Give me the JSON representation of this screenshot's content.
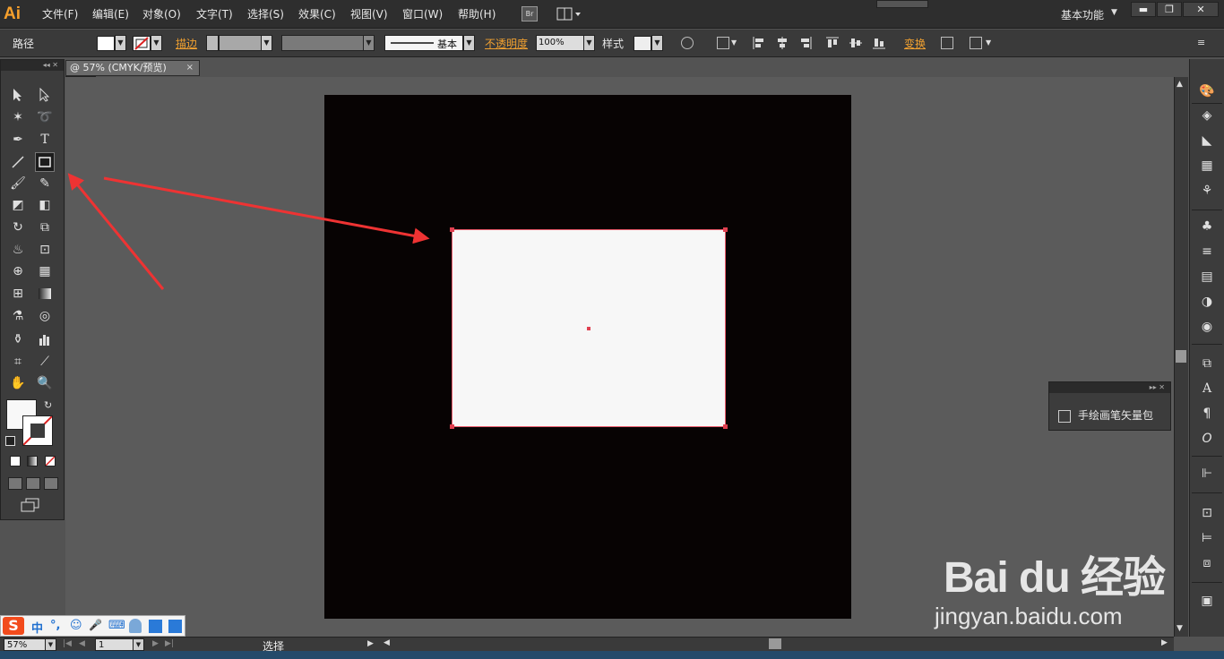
{
  "app": {
    "logo": "Ai"
  },
  "menu": {
    "items": [
      "文件(F)",
      "编辑(E)",
      "对象(O)",
      "文字(T)",
      "选择(S)",
      "效果(C)",
      "视图(V)",
      "窗口(W)",
      "帮助(H)"
    ],
    "bridge_label": "Br",
    "workspace": "基本功能"
  },
  "control_bar": {
    "object_type": "路径",
    "stroke_label": "描边",
    "stroke_style": "基本",
    "opacity_label": "不透明度",
    "opacity_value": "100%",
    "style_label": "样式",
    "transform_label": "变换"
  },
  "document": {
    "tab_title": "@ 57% (CMYK/预览)",
    "close": "×"
  },
  "brush_panel": {
    "item_label": "手绘画笔矢量包"
  },
  "status_bar": {
    "zoom": "57%",
    "page": "1",
    "current_tool": "选择"
  },
  "ime": {
    "items": [
      "中",
      "°,",
      "☺",
      "🎤",
      "⌨"
    ]
  },
  "watermark": {
    "logo": "Bai du 经验",
    "url": "jingyan.baidu.com"
  },
  "colors": {
    "accent_orange": "#f0a030",
    "artboard": "#070303",
    "selection": "#e04050",
    "annotation_arrow": "#ee3333"
  }
}
